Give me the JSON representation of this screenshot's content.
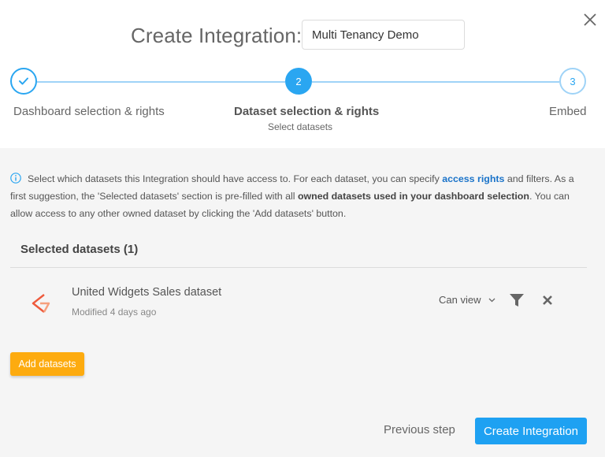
{
  "header": {
    "title": "Create Integration:",
    "integration_name": "Multi Tenancy Demo"
  },
  "icons": {
    "close": "close-icon",
    "check": "check-icon",
    "info": "info-icon",
    "filter": "filter-icon",
    "remove": "remove-icon",
    "chevron": "chevron-down-icon",
    "dataset_logo": "dataset-logo-icon"
  },
  "stepper": {
    "steps": [
      {
        "number": "1",
        "label": "Dashboard selection & rights",
        "state": "done"
      },
      {
        "number": "2",
        "label": "Dataset selection & rights",
        "sublabel": "Select datasets",
        "state": "active"
      },
      {
        "number": "3",
        "label": "Embed",
        "state": "future"
      }
    ]
  },
  "info": {
    "part1": "Select which datasets this Integration should have access to. For each dataset, you can specify ",
    "link": "access rights",
    "part2": " and filters. As a first suggestion, the 'Selected datasets' section is pre-filled with all ",
    "bold": "owned datasets used in your dashboard selection",
    "part3": ". You can allow access to any other owned dataset by clicking the 'Add datasets' button."
  },
  "selected": {
    "title": "Selected datasets (1)",
    "datasets": [
      {
        "name": "United Widgets Sales dataset",
        "modified": "Modified 4 days ago",
        "rights": "Can view"
      }
    ]
  },
  "buttons": {
    "add_datasets": "Add datasets",
    "previous": "Previous step",
    "create": "Create Integration"
  },
  "colors": {
    "accent": "#1ea1f2",
    "add_button": "#fdab0f",
    "link": "#1a73c9"
  }
}
